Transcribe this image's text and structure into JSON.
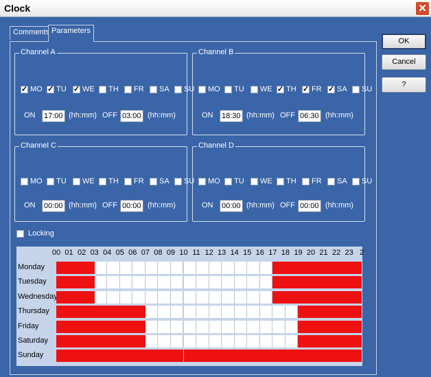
{
  "window": {
    "title": "Clock"
  },
  "tabs": [
    {
      "label": "Comments",
      "active": false
    },
    {
      "label": "Parameters",
      "active": true
    }
  ],
  "day_labels": [
    "MO",
    "TU",
    "WE",
    "TH",
    "FR",
    "SA",
    "SU"
  ],
  "channels": [
    {
      "name": "Channel A",
      "days": [
        true,
        true,
        true,
        false,
        false,
        false,
        false
      ],
      "on_label": "ON",
      "on": "17:00",
      "on_unit": "(hh:mm)",
      "off_label": "OFF",
      "off": "03:00",
      "off_unit": "(hh:mm)"
    },
    {
      "name": "Channel B",
      "days": [
        false,
        false,
        false,
        true,
        true,
        true,
        false
      ],
      "on_label": "ON",
      "on": "18:30",
      "on_unit": "(hh:mm)",
      "off_label": "OFF",
      "off": "06:30",
      "off_unit": "(hh:mm)"
    },
    {
      "name": "Channel C",
      "days": [
        false,
        false,
        false,
        false,
        false,
        false,
        false
      ],
      "on_label": "ON",
      "on": "00:00",
      "on_unit": "(hh:mm)",
      "off_label": "OFF",
      "off": "00:00",
      "off_unit": "(hh:mm)"
    },
    {
      "name": "Channel D",
      "days": [
        false,
        false,
        false,
        false,
        false,
        false,
        false
      ],
      "on_label": "ON",
      "on": "00:00",
      "on_unit": "(hh:mm)",
      "off_label": "OFF",
      "off": "00:00",
      "off_unit": "(hh:mm)"
    }
  ],
  "locking": {
    "label": "Locking",
    "checked": false
  },
  "buttons": {
    "ok": "OK",
    "cancel": "Cancel",
    "help": "?"
  },
  "schedule": {
    "hours": [
      "00",
      "01",
      "02",
      "03",
      "04",
      "05",
      "06",
      "07",
      "08",
      "09",
      "10",
      "11",
      "12",
      "13",
      "14",
      "15",
      "16",
      "17",
      "18",
      "19",
      "20",
      "21",
      "22",
      "23",
      "2"
    ],
    "days": [
      {
        "name": "Monday",
        "active": [
          1,
          1,
          1,
          0,
          0,
          0,
          0,
          0,
          0,
          0,
          0,
          0,
          0,
          0,
          0,
          0,
          0,
          1,
          1,
          1,
          1,
          1,
          1,
          1
        ]
      },
      {
        "name": "Tuesday",
        "active": [
          1,
          1,
          1,
          0,
          0,
          0,
          0,
          0,
          0,
          0,
          0,
          0,
          0,
          0,
          0,
          0,
          0,
          1,
          1,
          1,
          1,
          1,
          1,
          1
        ]
      },
      {
        "name": "Wednesday",
        "active": [
          1,
          1,
          1,
          0,
          0,
          0,
          0,
          0,
          0,
          0,
          0,
          0,
          0,
          0,
          0,
          0,
          0,
          1,
          1,
          1,
          1,
          1,
          1,
          1
        ]
      },
      {
        "name": "Thursday",
        "active": [
          1,
          1,
          1,
          1,
          1,
          1,
          1,
          0,
          0,
          0,
          0,
          0,
          0,
          0,
          0,
          0,
          0,
          0,
          0,
          1,
          1,
          1,
          1,
          1
        ]
      },
      {
        "name": "Friday",
        "active": [
          1,
          1,
          1,
          1,
          1,
          1,
          1,
          0,
          0,
          0,
          0,
          0,
          0,
          0,
          0,
          0,
          0,
          0,
          0,
          1,
          1,
          1,
          1,
          1
        ]
      },
      {
        "name": "Saturday",
        "active": [
          1,
          1,
          1,
          1,
          1,
          1,
          1,
          0,
          0,
          0,
          0,
          0,
          0,
          0,
          0,
          0,
          0,
          0,
          0,
          1,
          1,
          1,
          1,
          1
        ]
      },
      {
        "name": "Sunday",
        "active": [
          1,
          1,
          1,
          1,
          1,
          1,
          1,
          1,
          1,
          1,
          1,
          1,
          1,
          1,
          1,
          1,
          1,
          1,
          1,
          1,
          1,
          1,
          1,
          1
        ]
      }
    ]
  },
  "colors": {
    "background": "#3a65a8",
    "active_cell": "#ee1111",
    "grid_background": "#c6d4ea"
  }
}
